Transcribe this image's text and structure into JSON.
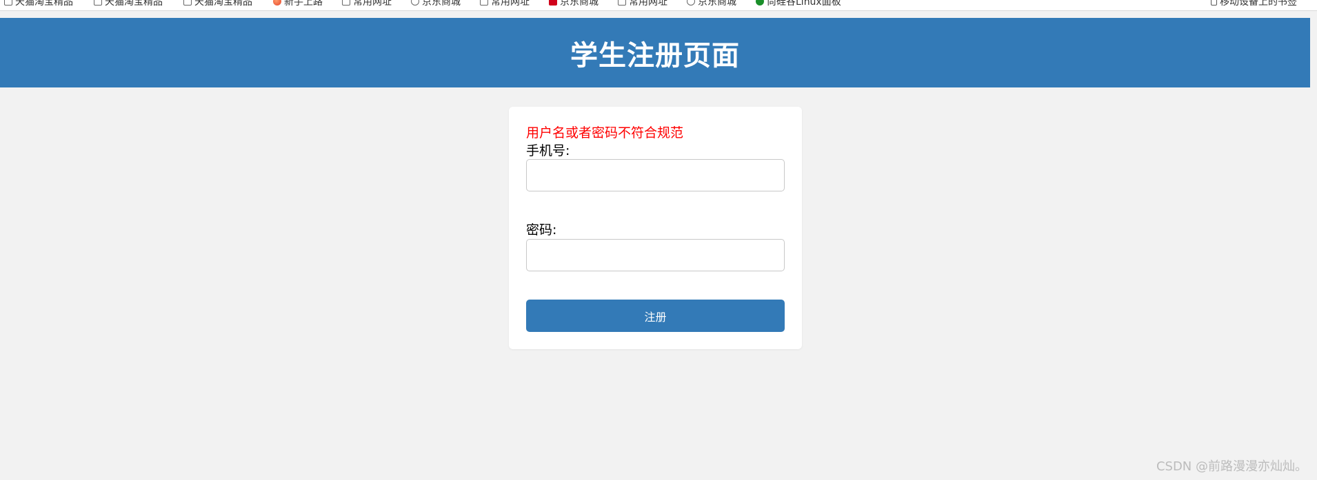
{
  "bookmarks": [
    {
      "label": "天猫淘宝精品",
      "icon": "page-icon"
    },
    {
      "label": "天猫淘宝精品",
      "icon": "page-icon"
    },
    {
      "label": "天猫淘宝精品",
      "icon": "page-icon"
    },
    {
      "label": "新手上路",
      "icon": "favicon-red"
    },
    {
      "label": "常用网址",
      "icon": "page-icon"
    },
    {
      "label": "京东商城",
      "icon": "globe-icon"
    },
    {
      "label": "常用网址",
      "icon": "page-icon"
    },
    {
      "label": "京东商城",
      "icon": "favicon-jd"
    },
    {
      "label": "常用网址",
      "icon": "page-icon"
    },
    {
      "label": "京东商城",
      "icon": "globe-icon"
    },
    {
      "label": "尚硅谷Linux面板",
      "icon": "favicon-green"
    }
  ],
  "mobile_bookmarks": {
    "label": "移动设备上的书签",
    "icon": "mobile-icon"
  },
  "header": {
    "title": "学生注册页面"
  },
  "form": {
    "error_message": "用户名或者密码不符合规范",
    "phone_label": "手机号:",
    "phone_value": "",
    "password_label": "密码:",
    "password_value": "",
    "submit_label": "注册"
  },
  "watermark": "CSDN @前路漫漫亦灿灿。",
  "colors": {
    "primary": "#337ab7",
    "error": "#ff0000",
    "background": "#f2f2f2"
  }
}
